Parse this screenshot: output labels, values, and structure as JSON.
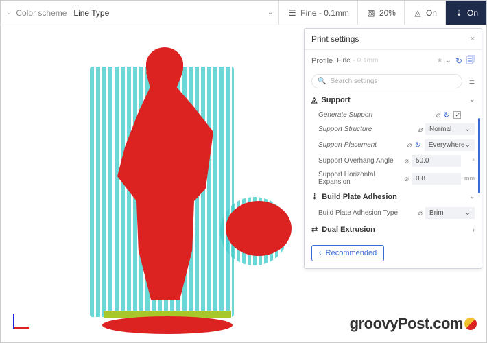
{
  "topbar": {
    "scheme_label": "Color scheme",
    "scheme_value": "Line Type",
    "quality": "Fine - 0.1mm",
    "infill": "20%",
    "support": "On",
    "adhesion": "On"
  },
  "panel": {
    "title": "Print settings",
    "profile_label": "Profile",
    "profile_value": "Fine",
    "profile_hint": "- 0.1mm",
    "search_placeholder": "Search settings",
    "sections": {
      "support": "Support",
      "adhesion": "Build Plate Adhesion",
      "dual": "Dual Extrusion"
    },
    "settings": {
      "gen_support": "Generate Support",
      "structure": "Support Structure",
      "structure_val": "Normal",
      "placement": "Support Placement",
      "placement_val": "Everywhere",
      "overhang": "Support Overhang Angle",
      "overhang_val": "50.0",
      "overhang_unit": "°",
      "horiz": "Support Horizontal Expansion",
      "horiz_val": "0.8",
      "horiz_unit": "mm",
      "adh_type": "Build Plate Adhesion Type",
      "adh_val": "Brim"
    },
    "recommended": "Recommended"
  },
  "watermark": "groovyPost.com"
}
